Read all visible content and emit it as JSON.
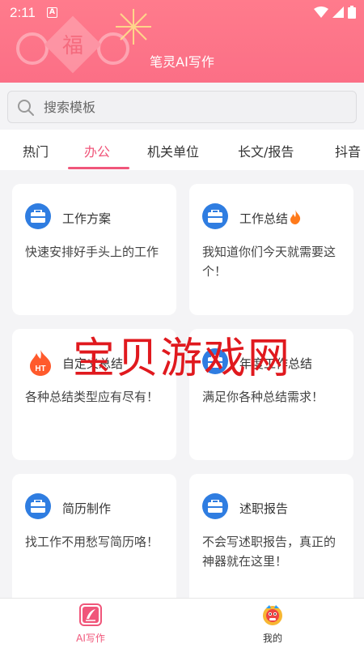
{
  "status": {
    "time": "2:11",
    "a_glyph": "A"
  },
  "header": {
    "title": "笔灵AI写作",
    "decor_char": "福"
  },
  "search": {
    "placeholder": "搜索模板"
  },
  "tabs": [
    {
      "label": "热门",
      "active": false
    },
    {
      "label": "办公",
      "active": true
    },
    {
      "label": "机关单位",
      "active": false
    },
    {
      "label": "长文/报告",
      "active": false
    },
    {
      "label": "抖音",
      "active": false
    }
  ],
  "cards": [
    {
      "title": "工作方案",
      "desc": "快速安排好手头上的工作",
      "hot": false,
      "icon": "briefcase-icon"
    },
    {
      "title": "工作总结",
      "desc": "我知道你们今天就需要这个！",
      "hot": true,
      "icon": "briefcase-icon"
    },
    {
      "title": "自定义总结",
      "desc": "各种总结类型应有尽有！",
      "hot": false,
      "badge": "HT",
      "icon": "hot-badge-icon"
    },
    {
      "title": "年度工作总结",
      "desc": "满足你各种总结需求！",
      "hot": false,
      "icon": "briefcase-icon"
    },
    {
      "title": "简历制作",
      "desc": "找工作不用愁写简历咯！",
      "hot": false,
      "icon": "briefcase-icon"
    },
    {
      "title": "述职报告",
      "desc": "不会写述职报告，真正的神器就在这里！",
      "hot": false,
      "icon": "briefcase-icon"
    }
  ],
  "watermark": "宝贝游戏网",
  "bottom_nav": [
    {
      "label": "AI写作",
      "active": true,
      "icon": "ai-writing-icon"
    },
    {
      "label": "我的",
      "active": false,
      "icon": "lion-mascot-icon"
    }
  ],
  "colors": {
    "accent": "#f0567a",
    "header": "#ff7b8c",
    "icon_blue": "#2f7de1",
    "fire": "#ff7a1a"
  }
}
